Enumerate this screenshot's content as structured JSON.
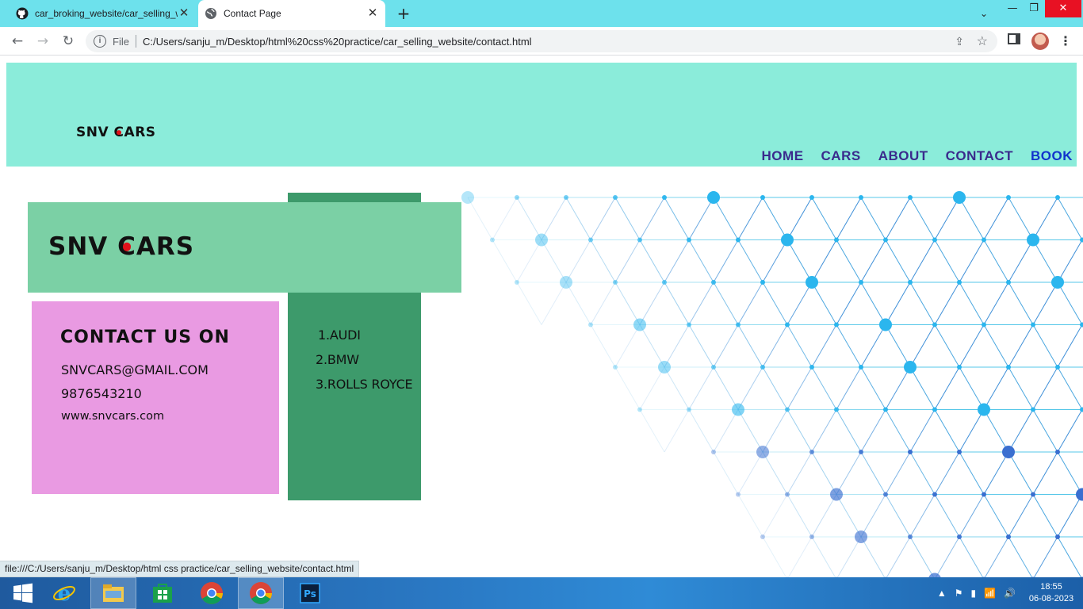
{
  "browser": {
    "tabs": [
      {
        "label": "car_broking_website/car_selling_website",
        "icon": "github-icon",
        "active": false
      },
      {
        "label": "Contact Page",
        "icon": "globe-icon",
        "active": true
      }
    ],
    "new_tab": "+",
    "address": {
      "scheme_label": "File",
      "url": "C:/Users/sanju_m/Desktop/html%20css%20practice/car_selling_website/contact.html"
    },
    "status_url": "file:///C:/Users/sanju_m/Desktop/html css practice/car_selling_website/contact.html"
  },
  "page": {
    "header": {
      "logo": {
        "pre": "SNV ",
        "c": "C",
        "post": "ARS"
      },
      "nav": [
        "HOME",
        "CARS",
        "ABOUT",
        "CONTACT",
        "BOOK"
      ]
    },
    "banner": {
      "logo": {
        "pre": "SNV ",
        "c": "C",
        "post": "ARS"
      }
    },
    "cars": [
      "1.AUDI",
      "2.BMW",
      "3.ROLLS ROYCE"
    ],
    "contact": {
      "title": "CONTACT US ON",
      "email": "SNVCARS@GMAIL.COM",
      "phone": "9876543210",
      "website": "www.snvcars.com"
    },
    "colors": {
      "header_bg": "#8becda",
      "banner_bg": "#7bd0a5",
      "dark_column": "#3d9a6b",
      "contact_bg": "#e99ae2",
      "nav_text": "#3a2a8c",
      "nav_book": "#1133cc",
      "logo_dot": "#e0101a"
    }
  },
  "taskbar": {
    "apps": [
      "windows-start-icon",
      "internet-explorer-icon",
      "file-explorer-icon",
      "windows-store-icon",
      "chrome-icon",
      "chrome-icon",
      "photoshop-icon"
    ],
    "time": "18:55",
    "date": "06-08-2023"
  }
}
